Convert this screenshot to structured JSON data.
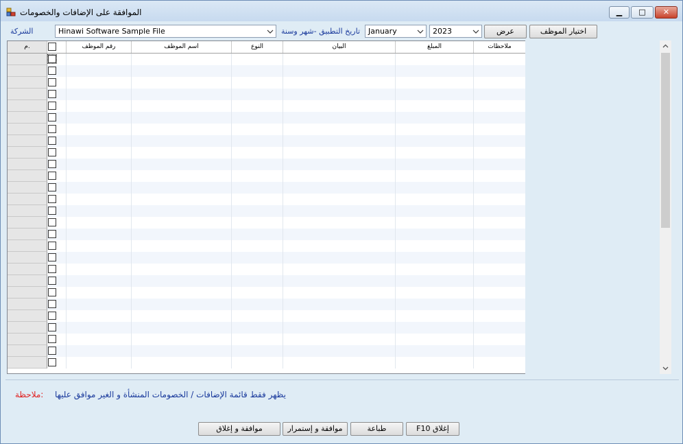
{
  "window": {
    "title": "الموافقة على الإضافات والخصومات"
  },
  "toolbar": {
    "company_label": "الشركة",
    "company_value": "Hinawi Software Sample File",
    "date_label": "تاريخ التطبيق -شهر وسنة",
    "month_value": "January",
    "year_value": "2023",
    "show_button": "عرض",
    "select_employee_button": "اختيار الموظف"
  },
  "grid": {
    "columns": {
      "row_num": "م.",
      "employee_no": "رقم الموظف",
      "employee_name": "اسم الموظف",
      "type": "النوع",
      "description": "البيان",
      "amount": "المبلغ",
      "notes": "ملاحظات"
    },
    "row_count": 27
  },
  "note": {
    "label": "ملاحظة:",
    "text": "يظهر فقط قائمة الإضافات / الخصومات المنشأة و الغير موافق عليها"
  },
  "buttons": {
    "approve_close": "موافقة و إغلاق",
    "approve_continue": "موافقة و إستمرار",
    "print": "طباعة",
    "close": "F10 إغلاق"
  },
  "colors": {
    "label_blue": "#1a3a9c",
    "note_red": "#e02020",
    "note_blue": "#1a3a9c",
    "row_alt": "#f2f6fc"
  }
}
